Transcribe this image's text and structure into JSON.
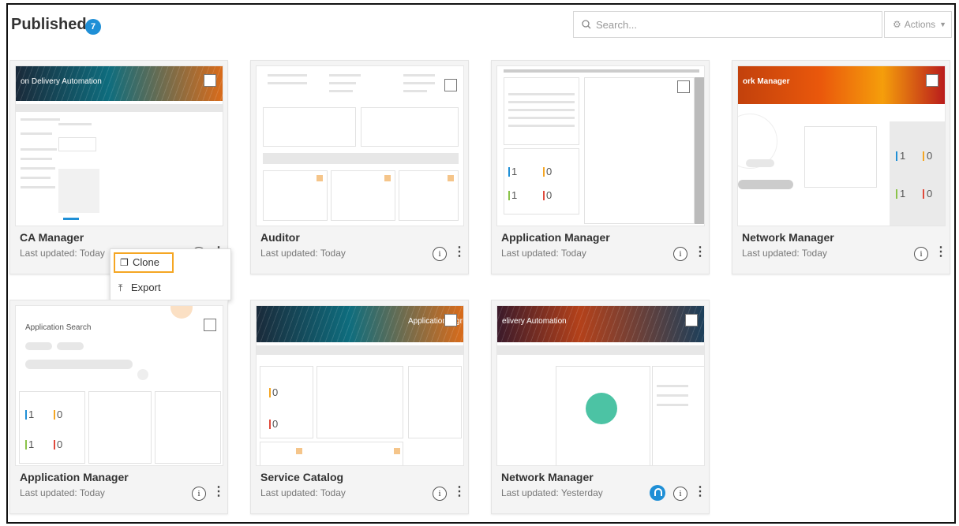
{
  "header": {
    "title": "Published",
    "count": "7",
    "search_placeholder": "Search...",
    "actions_label": "Actions"
  },
  "cards": [
    {
      "name": "CA Manager",
      "updated": "Last updated: Today",
      "thumb_title": "on Delivery Automation"
    },
    {
      "name": "Auditor",
      "updated": "Last updated: Today"
    },
    {
      "name": "Application Manager",
      "updated": "Last updated: Today"
    },
    {
      "name": "Network Manager",
      "updated": "Last updated: Today",
      "thumb_title": "ork Manager"
    },
    {
      "name": "Application Manager",
      "updated": "Last updated: Today",
      "thumb_title": "Application Search"
    },
    {
      "name": "Service Catalog",
      "updated": "Last updated: Today",
      "thumb_title": "Application Mgr"
    },
    {
      "name": "Network Manager",
      "updated": "Last updated: Yesterday",
      "thumb_title": "elivery Automation"
    }
  ],
  "context_menu": {
    "clone_label": "Clone",
    "export_label": "Export"
  },
  "colors": {
    "accent": "#1f8fd6",
    "highlight": "#f5a623",
    "teal": "#4cc3a4"
  },
  "icons": {
    "search": "search-icon",
    "gear": "gear-icon",
    "info": "info-icon",
    "more": "kebab-icon",
    "share": "share-icon",
    "clone": "clone-icon",
    "export": "export-icon"
  }
}
